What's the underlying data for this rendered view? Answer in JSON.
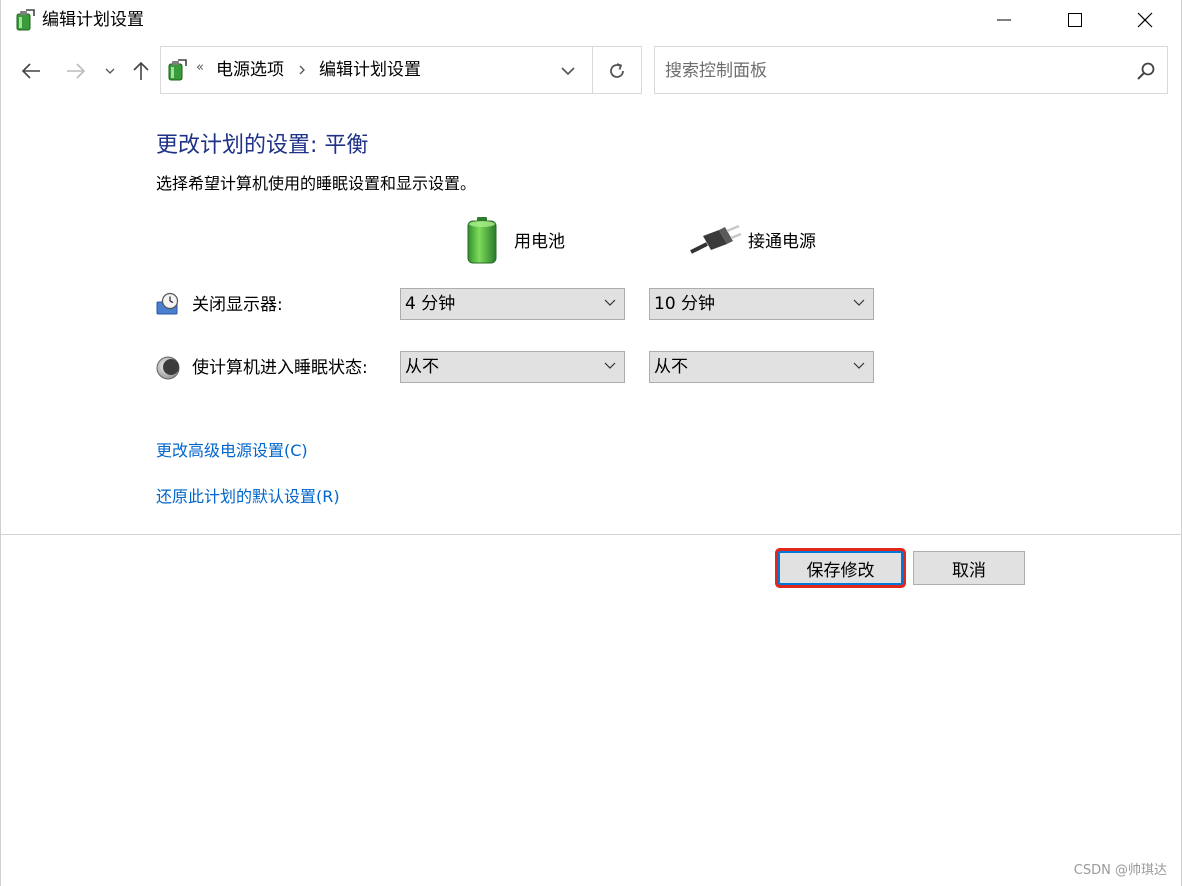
{
  "window": {
    "title": "编辑计划设置"
  },
  "nav": {
    "back_icon": "arrow-left-icon",
    "forward_icon": "arrow-right-icon",
    "up_icon": "arrow-up-icon"
  },
  "address": {
    "separator": "«",
    "crumbs": [
      "电源选项",
      "编辑计划设置"
    ]
  },
  "search": {
    "placeholder": "搜索控制面板",
    "value": ""
  },
  "page": {
    "heading": "更改计划的设置: 平衡",
    "subtext": "选择希望计算机使用的睡眠设置和显示设置。",
    "columns": {
      "battery": "用电池",
      "plugged": "接通电源"
    },
    "rows": [
      {
        "label": "关闭显示器:",
        "battery": "4 分钟",
        "plugged": "10 分钟"
      },
      {
        "label": "使计算机进入睡眠状态:",
        "battery": "从不",
        "plugged": "从不"
      }
    ],
    "links": {
      "advanced": "更改高级电源设置(C)",
      "restore": "还原此计划的默认设置(R)"
    },
    "buttons": {
      "save": "保存修改",
      "cancel": "取消"
    }
  },
  "watermark": "CSDN @帅琪达",
  "colors": {
    "heading": "#1e3287",
    "link": "#0066cc",
    "highlight": "#e1261c"
  }
}
